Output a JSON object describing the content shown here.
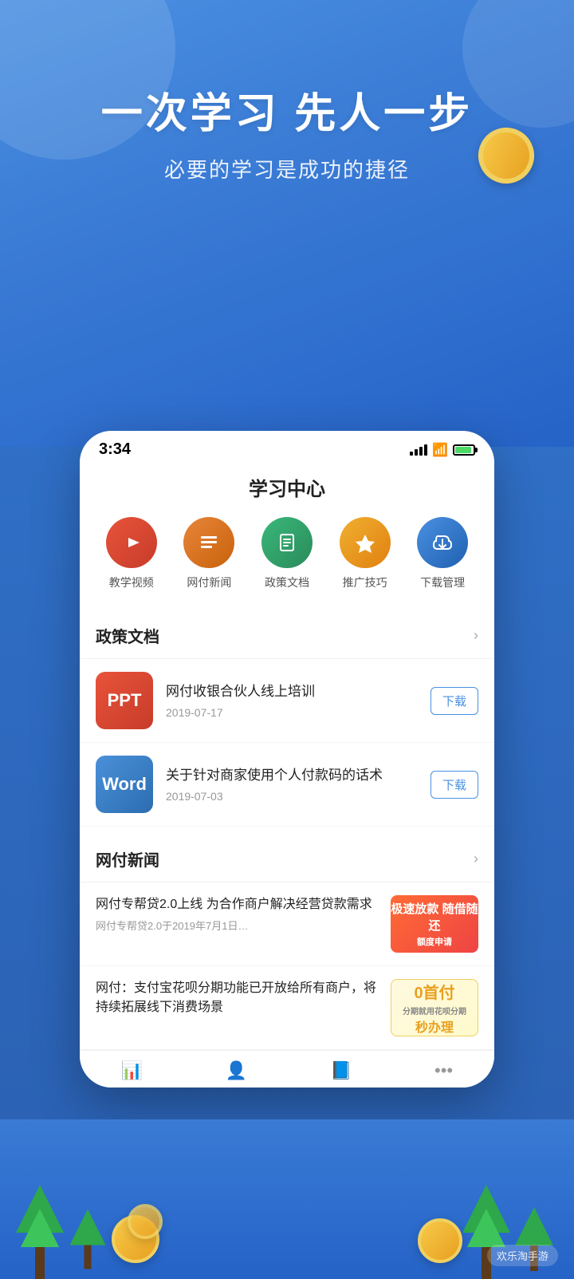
{
  "app": {
    "name": "学习中心",
    "status_time": "3:34"
  },
  "hero": {
    "title": "一次学习 先人一步",
    "subtitle": "必要的学习是成功的捷径"
  },
  "icons": [
    {
      "id": "teaching-video",
      "label": "教学视频",
      "color": "#e8533a",
      "emoji": "▶"
    },
    {
      "id": "news",
      "label": "网付新闻",
      "color": "#e8853a",
      "emoji": "📰"
    },
    {
      "id": "policy",
      "label": "政策文档",
      "color": "#3ab87a",
      "emoji": "📁"
    },
    {
      "id": "tips",
      "label": "推广技巧",
      "color": "#e8a020",
      "emoji": "🚀"
    },
    {
      "id": "download",
      "label": "下载管理",
      "color": "#4a90e2",
      "emoji": "⬇"
    }
  ],
  "policy_section": {
    "title": "政策文档",
    "arrow": "›",
    "documents": [
      {
        "type": "PPT",
        "title": "网付收银合伙人线上培训",
        "date": "2019-07-17",
        "download_label": "下载"
      },
      {
        "type": "Word",
        "title": "关于针对商家使用个人付款码的话术",
        "date": "2019-07-03",
        "download_label": "下载"
      }
    ]
  },
  "news_section": {
    "title": "网付新闻",
    "arrow": "›",
    "articles": [
      {
        "title": "网付专帮贷2.0上线 为合作商户解决经营贷款需求",
        "subtitle": "网付专帮贷2.0于2019年7月1日…",
        "banner_line1": "极速放款 随借随还",
        "banner_line2": "额度申请",
        "banner_type": "red"
      },
      {
        "title": "网付：支付宝花呗分期功能已开放给所有商户，将持续拓展线下消费场景",
        "subtitle": "",
        "banner_line1": "0首付",
        "banner_line2": "分期就用花呗分期",
        "banner_line3": "秒办理",
        "banner_type": "yellow"
      }
    ]
  },
  "bottom_nav": [
    {
      "id": "home",
      "icon": "📊",
      "label": ""
    },
    {
      "id": "user",
      "icon": "👤",
      "label": ""
    },
    {
      "id": "book",
      "icon": "📘",
      "label": ""
    },
    {
      "id": "more",
      "icon": "⋯",
      "label": ""
    }
  ],
  "watermark": "欢乐淘手游"
}
